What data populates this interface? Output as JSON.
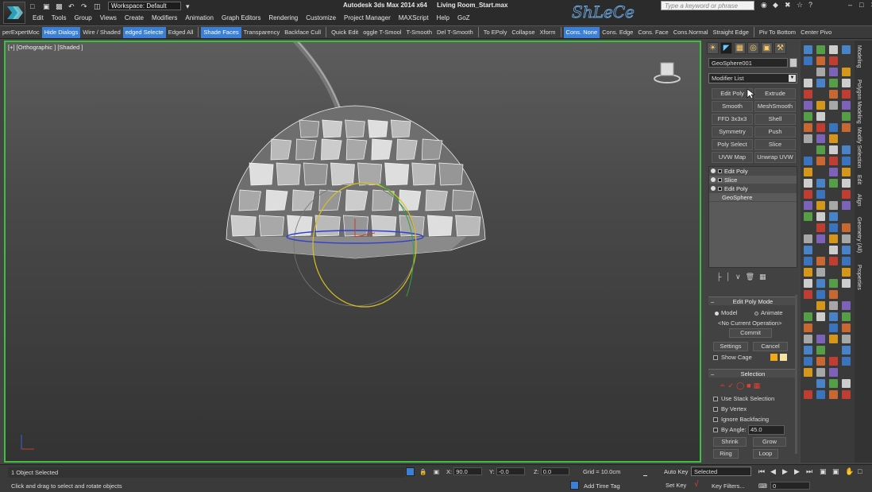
{
  "app": {
    "title": "Autodesk 3ds Max  2014 x64",
    "file": "Living Room_Start.max",
    "workspace": "Workspace: Default",
    "search_placeholder": "Type a keyword or phrase",
    "watermark": "ShLeCe"
  },
  "menu": [
    "Edit",
    "Tools",
    "Group",
    "Views",
    "Create",
    "Modifiers",
    "Animation",
    "Graph Editors",
    "Rendering",
    "Customize",
    "Project Manager",
    "MAXScript",
    "Help",
    "GoZ"
  ],
  "ribbon": [
    {
      "label": "perExpertMoc",
      "on": false
    },
    {
      "label": "Hide Dialogs",
      "on": true
    },
    {
      "label": "Wire / Shaded",
      "on": false
    },
    {
      "label": "edged Selecte",
      "on": true
    },
    {
      "label": "Edged All",
      "on": false
    },
    {
      "sep": true
    },
    {
      "label": "Shade Faces",
      "on": true
    },
    {
      "label": "Transparency",
      "on": false
    },
    {
      "label": "Backface Cull",
      "on": false
    },
    {
      "sep": true
    },
    {
      "label": "Quick Edit",
      "on": false
    },
    {
      "label": "oggle T-Smool",
      "on": false
    },
    {
      "label": "T-Smooth",
      "on": false
    },
    {
      "label": "Del T-Smooth",
      "on": false
    },
    {
      "sep": true
    },
    {
      "label": "To EPoly",
      "on": false
    },
    {
      "label": "Collapse",
      "on": false
    },
    {
      "label": "Xform",
      "on": false
    },
    {
      "sep": true
    },
    {
      "label": "Cons. None",
      "on": true
    },
    {
      "label": "Cons. Edge",
      "on": false
    },
    {
      "label": "Cons. Face",
      "on": false
    },
    {
      "label": "Cons.Normal",
      "on": false
    },
    {
      "label": "Straight Edge",
      "on": false
    },
    {
      "sep": true
    },
    {
      "label": "Piv To Bottom",
      "on": false
    },
    {
      "label": "Center Pivo",
      "on": false
    }
  ],
  "viewport": {
    "label": "[+] [Orthographic ] [Shaded ]"
  },
  "command_panel": {
    "object_name": "GeoSphere001",
    "modifier_list": "Modifier List",
    "modifier_buttons": [
      "Edit Poly",
      "Extrude",
      "Smooth",
      "MeshSmooth",
      "FFD 3x3x3",
      "Shell",
      "Symmetry",
      "Push",
      "Poly Select",
      "Slice",
      "UVW Map",
      "Unwrap UVW"
    ],
    "stack": [
      {
        "label": "Edit Poly",
        "icons": true
      },
      {
        "label": "Slice",
        "icons": true
      },
      {
        "label": "Edit Poly",
        "icons": true
      },
      {
        "label": "GeoSphere",
        "icons": false
      }
    ],
    "edit_poly_mode": {
      "title": "Edit Poly Mode",
      "model": "Model",
      "animate": "Animate",
      "operation": "<No Current Operation>",
      "commit": "Commit",
      "settings": "Settings",
      "cancel": "Cancel",
      "show_cage": "Show Cage"
    },
    "selection": {
      "title": "Selection",
      "use_stack": "Use Stack Selection",
      "by_vertex": "By Vertex",
      "ignore_backfacing": "Ignore Backfacing",
      "by_angle": "By Angle:",
      "angle_value": "45.0",
      "shrink": "Shrink",
      "grow": "Grow",
      "ring": "Ring",
      "loop": "Loop"
    }
  },
  "side_tabs": [
    "Modeling",
    "Polygon Modeling",
    "Modify Selection",
    "Edit",
    "Align",
    "Geometry (All)",
    "Properties"
  ],
  "status": {
    "selected": "1 Object Selected",
    "hint": "Click and drag to select and rotate objects",
    "x_label": "X:",
    "x_value": "90.0",
    "y_label": "Y:",
    "y_value": "-0.0",
    "z_label": "Z:",
    "z_value": "0.0",
    "grid": "Grid = 10.0cm",
    "add_time_tag": "Add Time Tag",
    "auto_key": "Auto Key",
    "selected_dd": "Selected",
    "set_key": "Set Key",
    "key_filters": "Key Filters...",
    "frame": "0"
  },
  "colors": {
    "viewport_border": "#3fbf3f",
    "accent_blue": "#3b7fd6",
    "swatch_orange": "#f0a818",
    "swatch_cream": "#f4e4a0"
  }
}
